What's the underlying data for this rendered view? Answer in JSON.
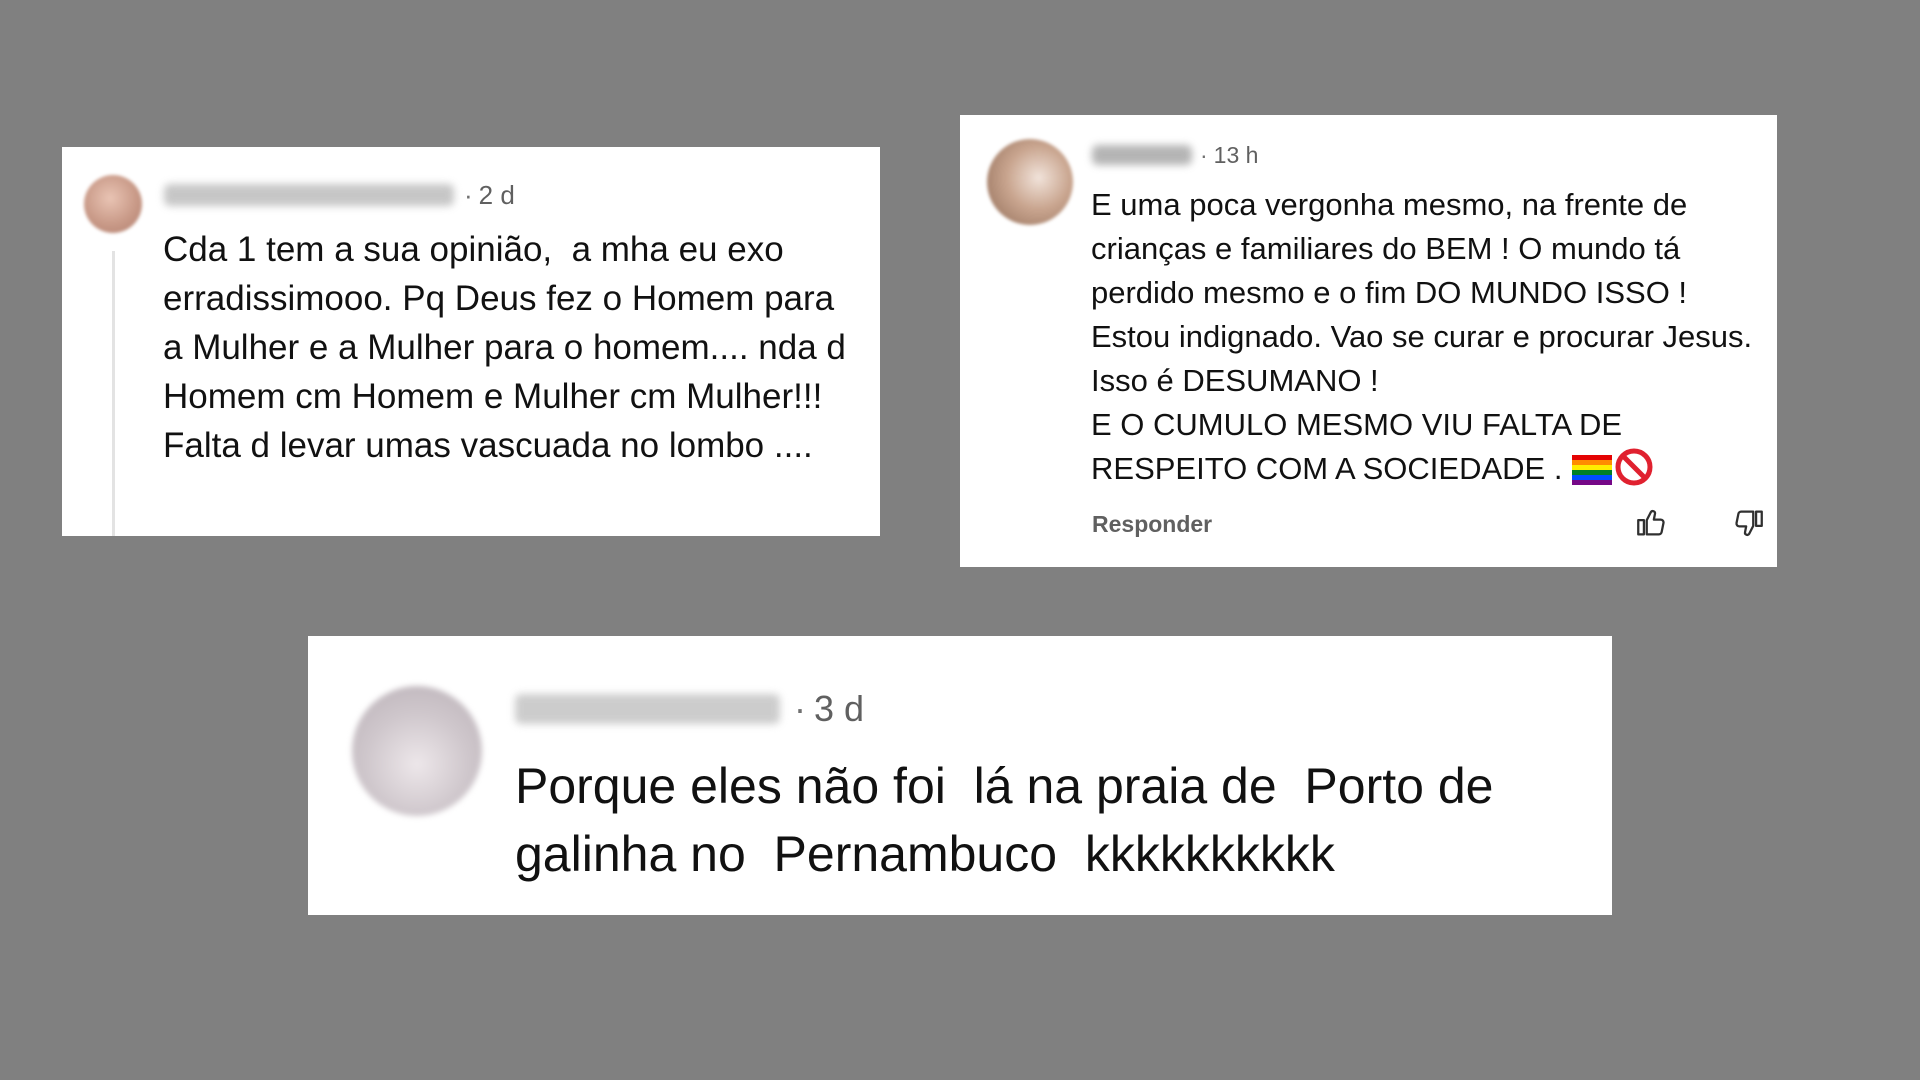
{
  "comments": [
    {
      "time": "2 d",
      "separator": "·",
      "text": "Cda 1 tem a sua opinião,  a mha eu exo erradissimooo. Pq Deus fez o Homem para a Mulher e a Mulher para o homem.... nda d Homem cm Homem e Mulher cm Mulher!!! Falta d levar umas vascuada no lombo ...."
    },
    {
      "time": "13 h",
      "separator": "·",
      "text": "E uma poca vergonha mesmo, na frente de crianças e familiares do BEM ! O mundo tá perdido mesmo e o fim DO MUNDO ISSO ! Estou indignado. Vao se curar e procurar Jesus. Isso é DESUMANO !\nE O CUMULO MESMO VIU FALTA DE RESPEITO COM A SOCIEDADE .",
      "emoji_icons": [
        "rainbow-flag-icon",
        "no-entry-icon"
      ],
      "reply_label": "Responder"
    },
    {
      "time": "3 d",
      "separator": "·",
      "text": "Porque eles não foi  lá na praia de  Porto de galinha no  Pernambuco  kkkkkkkkkk"
    }
  ],
  "colors": {
    "background": "#808080",
    "card": "#ffffff",
    "text": "#111111",
    "meta": "#606060"
  }
}
